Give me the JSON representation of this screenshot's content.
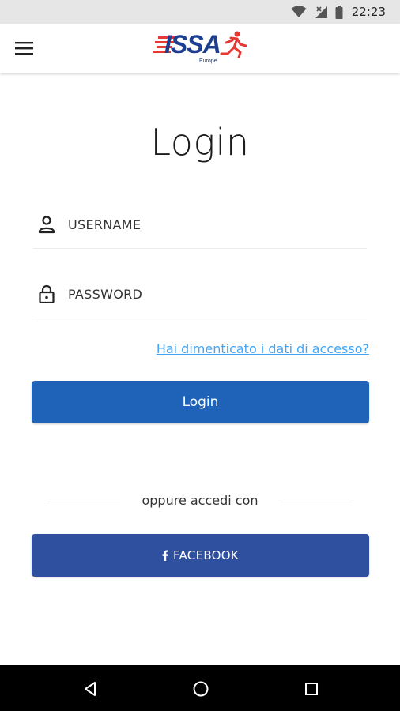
{
  "status_bar": {
    "time": "22:23",
    "icons": [
      "wifi-icon",
      "signal-icon",
      "battery-icon"
    ]
  },
  "app_bar": {
    "menu_icon": "hamburger-menu-icon",
    "logo_text": "ISSA",
    "logo_subtext": "Europe"
  },
  "login": {
    "title": "Login",
    "username_placeholder": "USERNAME",
    "password_placeholder": "PASSWORD",
    "forgot_link": "Hai dimenticato i dati di accesso?",
    "login_button": "Login",
    "divider_text": "oppure accedi con",
    "facebook_button": "FACEBOOK"
  },
  "colors": {
    "primary": "#1e63b8",
    "facebook": "#2f4f9f",
    "link": "#42a5f5",
    "logo_blue": "#1d3f8f",
    "logo_red": "#e53935"
  },
  "nav_bar": {
    "icons": [
      "back-icon",
      "home-icon",
      "recents-icon"
    ]
  }
}
